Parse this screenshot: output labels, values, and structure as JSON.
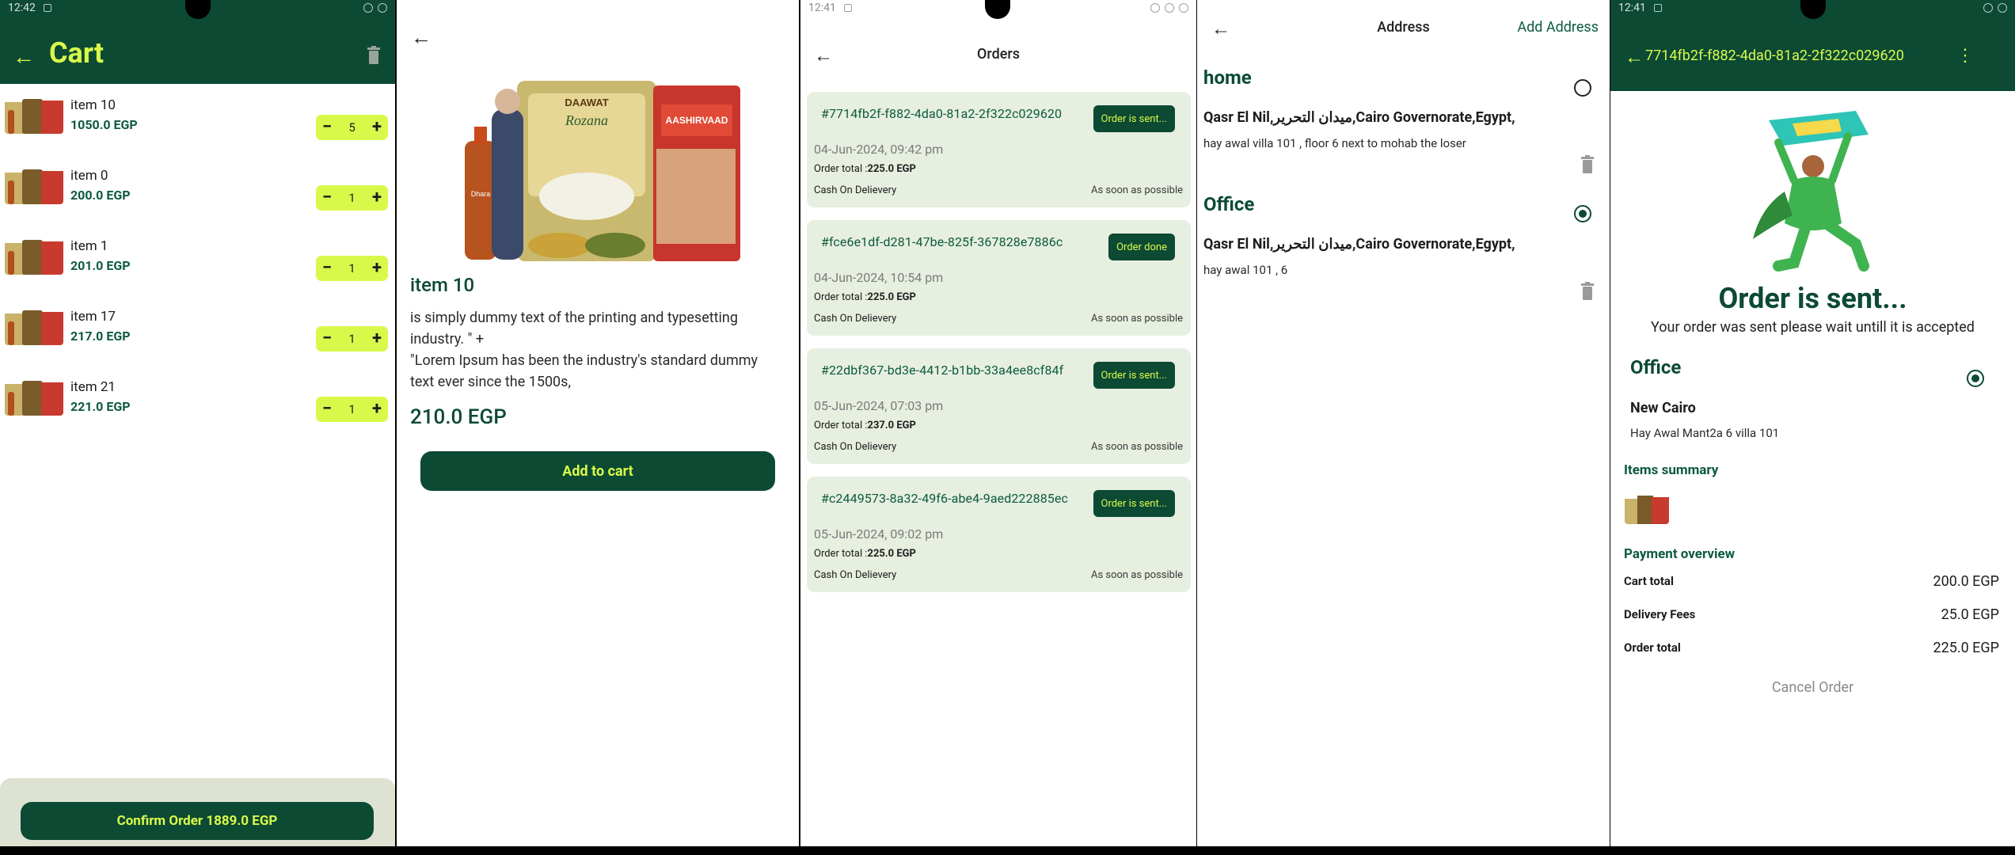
{
  "status_bars": {
    "cart_time": "12:42",
    "orders_time": "12:41",
    "order_status_time": "12:41"
  },
  "cart": {
    "title": "Cart",
    "items": [
      {
        "name": "item 10",
        "price": "1050.0 EGP",
        "qty": "5"
      },
      {
        "name": "item 0",
        "price": "200.0 EGP",
        "qty": "1"
      },
      {
        "name": "item 1",
        "price": "201.0 EGP",
        "qty": "1"
      },
      {
        "name": "item 17",
        "price": "217.0 EGP",
        "qty": "1"
      },
      {
        "name": "item 21",
        "price": "221.0 EGP",
        "qty": "1"
      }
    ],
    "confirm_label": "Confirm Order 1889.0 EGP"
  },
  "product": {
    "name": "item 10",
    "description": "is simply dummy text of the printing and typesetting industry. \" +\n \"Lorem Ipsum has been the industry's standard dummy text ever since the 1500s,",
    "price": "210.0 EGP",
    "add_label": "Add to cart",
    "image_labels": {
      "left_bag": "DAAWAT",
      "left_bag_sub": "Rozana",
      "right_bag": "AASHIRVAAD",
      "bottle": "Dhara"
    }
  },
  "orders": {
    "title": "Orders",
    "list": [
      {
        "id": "#7714fb2f-f882-4da0-81a2-2f322c029620",
        "status": "Order is sent...",
        "date": "04-Jun-2024, 09:42 pm",
        "total_label": "Order total :",
        "total": "225.0 EGP",
        "payment": "Cash On Delievery",
        "delivery": "As soon as possible"
      },
      {
        "id": "#fce6e1df-d281-47be-825f-367828e7886c",
        "status": "Order done",
        "date": "04-Jun-2024, 10:54 pm",
        "total_label": "Order total :",
        "total": "225.0 EGP",
        "payment": "Cash On Delievery",
        "delivery": "As soon as possible"
      },
      {
        "id": "#22dbf367-bd3e-4412-b1bb-33a4ee8cf84f",
        "status": "Order is sent...",
        "date": "05-Jun-2024, 07:03 pm",
        "total_label": "Order total :",
        "total": "237.0 EGP",
        "payment": "Cash On Delievery",
        "delivery": "As soon as possible"
      },
      {
        "id": "#c2449573-8a32-49f6-abe4-9aed222885ec",
        "status": "Order is sent...",
        "date": "05-Jun-2024, 09:02 pm",
        "total_label": "Order total :",
        "total": "225.0 EGP",
        "payment": "Cash On Delievery",
        "delivery": "As soon as possible"
      }
    ]
  },
  "address": {
    "title": "Address",
    "add_label": "Add Address",
    "list": [
      {
        "name": "home",
        "line1": "Qasr El Nil,ميدان التحرير,Cairo Governorate,Egypt,",
        "line2": "hay awal villa 101 , floor 6 next to mohab the loser",
        "selected": false
      },
      {
        "name": "Office",
        "line1": "Qasr El Nil,ميدان التحرير,Cairo Governorate,Egypt,",
        "line2": "hay awal 101 , 6",
        "selected": true
      }
    ]
  },
  "order_status": {
    "order_id": "7714fb2f-f882-4da0-81a2-2f322c029620",
    "title": "Order is sent...",
    "subtitle": "Your order was sent please wait untill it is accepted",
    "address_name": "Office",
    "address_city": "New Cairo",
    "address_line": "Hay Awal Mant2a 6 villa 101",
    "items_summary_label": "Items summary",
    "payment_overview_label": "Payment overview",
    "cart_total_label": "Cart total",
    "cart_total": "200.0 EGP",
    "delivery_label": "Delivery Fees",
    "delivery": "25.0 EGP",
    "order_total_label": "Order total",
    "order_total": "225.0 EGP",
    "cancel_label": "Cancel Order"
  },
  "colors": {
    "primary": "#0c4a34",
    "accent": "#d9f94a",
    "card": "#e6efe0"
  }
}
